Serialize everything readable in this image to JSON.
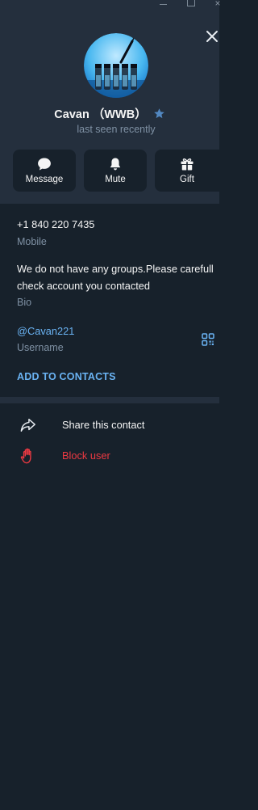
{
  "profile": {
    "name": "Cavan （WWB）",
    "status": "last seen recently"
  },
  "actions": {
    "message": "Message",
    "mute": "Mute",
    "gift": "Gift"
  },
  "info": {
    "phone": "+1 840 220 7435",
    "phone_label": "Mobile",
    "bio_line1": "We do not have any groups.Please carefull",
    "bio_line2": "check account you contacted",
    "bio_label": "Bio",
    "username": "@Cavan221",
    "username_label": "Username",
    "add_contacts": "ADD TO CONTACTS"
  },
  "menu": {
    "share": "Share this contact",
    "block": "Block user"
  },
  "colors": {
    "background": "#17212b",
    "header_bg": "#242f3d",
    "accent": "#6ab3f3",
    "danger": "#ec3942",
    "muted_text": "#7f91a4",
    "premium_star": "#5288c1"
  },
  "icons": {
    "close": "close-icon",
    "star": "premium-star-icon",
    "message": "chat-bubble-icon",
    "mute": "bell-icon",
    "gift": "gift-icon",
    "qr": "qr-code-icon",
    "share": "share-arrow-icon",
    "block": "hand-stop-icon"
  }
}
